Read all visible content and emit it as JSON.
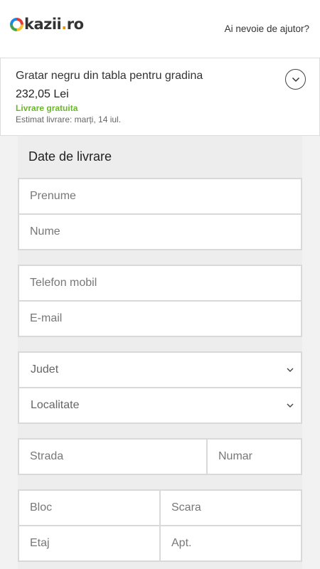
{
  "header": {
    "logo": {
      "o": "O",
      "main": "kazii",
      "dot": ".",
      "tld": "ro"
    },
    "help_link": "Ai nevoie de ajutor?"
  },
  "order": {
    "product_name": "Gratar negru din tabla pentru gradina",
    "price": "232,05 Lei",
    "shipping": "Livrare gratuita",
    "estimate": "Estimat livrare: marți, 14 iul.",
    "expand_icon": "chevron-down-icon"
  },
  "form": {
    "title": "Date de livrare",
    "first_name": {
      "placeholder": "Prenume",
      "value": ""
    },
    "last_name": {
      "placeholder": "Nume",
      "value": ""
    },
    "phone": {
      "placeholder": "Telefon mobil",
      "value": ""
    },
    "email": {
      "placeholder": "E-mail",
      "value": ""
    },
    "county": {
      "selected": "Judet"
    },
    "city": {
      "selected": "Localitate"
    },
    "street": {
      "placeholder": "Strada",
      "value": ""
    },
    "number": {
      "placeholder": "Numar",
      "value": ""
    },
    "block": {
      "placeholder": "Bloc",
      "value": ""
    },
    "stair": {
      "placeholder": "Scara",
      "value": ""
    },
    "floor": {
      "placeholder": "Etaj",
      "value": ""
    },
    "apt": {
      "placeholder": "Apt.",
      "value": ""
    }
  },
  "colors": {
    "accent_orange": "#f39200",
    "shipping_green": "#6bb52b"
  }
}
